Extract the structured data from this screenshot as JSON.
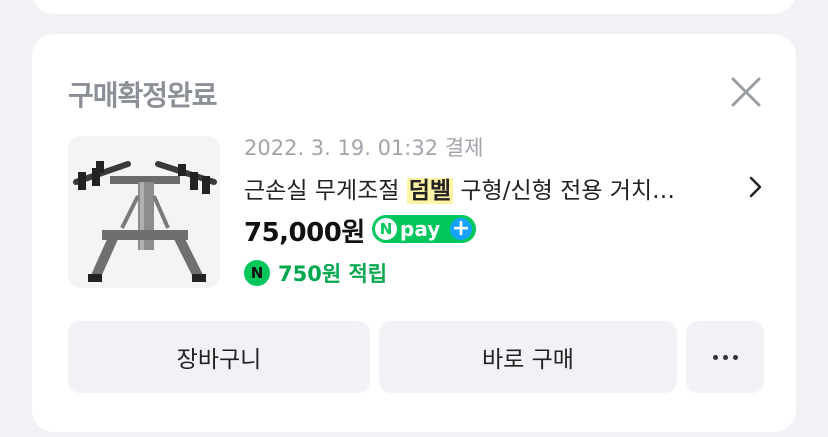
{
  "order": {
    "status": "구매확정완료",
    "payment_date": "2022. 3. 19. 01:32 결제",
    "product_title_pre": "근손실 무게조절 ",
    "product_title_highlight": "덤벨",
    "product_title_post": " 구형/신형 전용 거치…",
    "price": "75,000원",
    "npay_n": "N",
    "npay_label": "pay",
    "npay_plus": "+",
    "points_icon": "N",
    "points": "750원 적립"
  },
  "actions": {
    "cart_label": "장바구니",
    "buy_label": "바로 구매"
  },
  "icons": {
    "close": "close-icon",
    "chevron": "chevron-right-icon",
    "more": "more-dots-icon"
  },
  "colors": {
    "npay_green": "#03c75a",
    "points_green": "#03a84e",
    "plus_blue": "#15a3ff",
    "highlight": "#fff3a5"
  }
}
